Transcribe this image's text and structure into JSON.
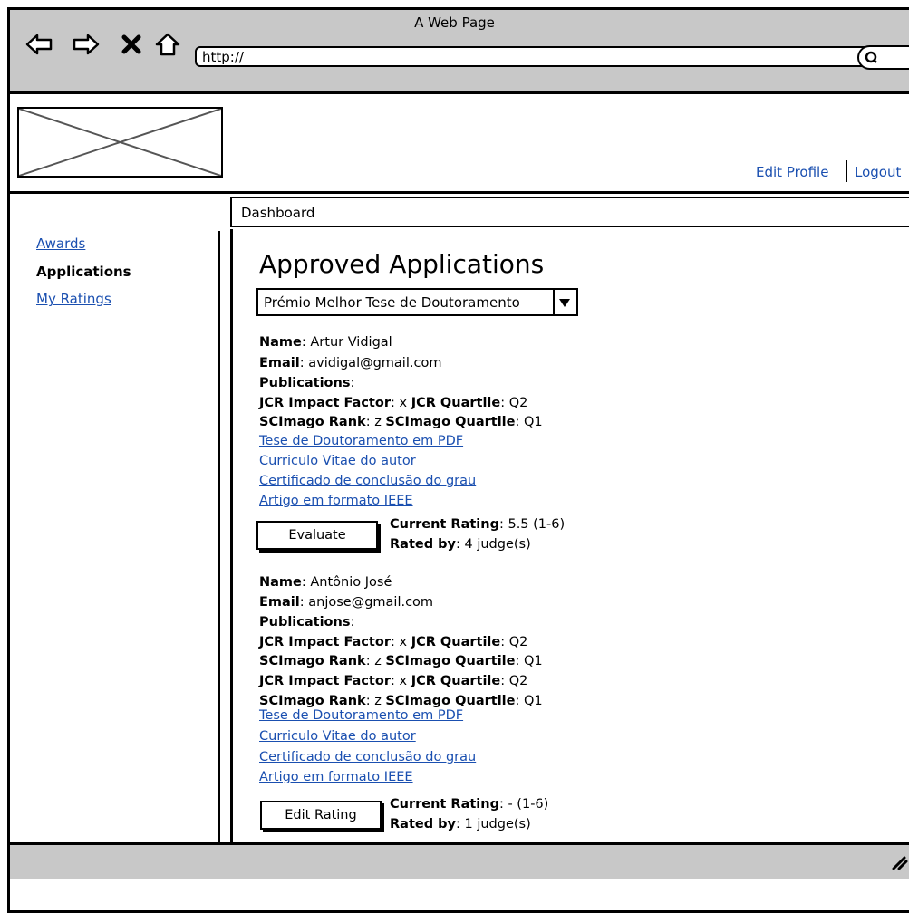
{
  "browser": {
    "title": "A Web Page",
    "url": "http://"
  },
  "header": {
    "edit_profile": "Edit Profile",
    "logout": "Logout"
  },
  "sidebar": {
    "items": [
      {
        "label": "Awards",
        "active": false
      },
      {
        "label": "Applications",
        "active": true
      },
      {
        "label": "My Ratings",
        "active": false
      }
    ]
  },
  "breadcrumb": "Dashboard",
  "main": {
    "heading": "Approved Applications",
    "award_select": "Prémio Melhor Tese de Doutoramento",
    "applications": [
      {
        "name_label": "Name",
        "name": "Artur Vidigal",
        "email_label": "Email",
        "email": "avidigal@gmail.com",
        "publications_label": "Publications",
        "metrics": [
          {
            "a_label": "JCR Impact Factor",
            "a": "x",
            "b_label": "JCR Quartile",
            "b": "Q2"
          },
          {
            "a_label": "SCImago Rank",
            "a": "z",
            "b_label": "SCImago Quartile",
            "b": "Q1"
          }
        ],
        "documents": [
          "Tese de Doutoramento em PDF",
          "Curriculo Vitae do autor",
          "Certificado de conclusão do grau",
          "Artigo em formato IEEE"
        ],
        "button": "Evaluate",
        "rating_label": "Current Rating",
        "rating": "5.5 (1-6)",
        "rated_by_label": "Rated by",
        "rated_by": "4 judge(s)"
      },
      {
        "name_label": "Name",
        "name": "Antônio José",
        "email_label": "Email",
        "email": "anjose@gmail.com",
        "publications_label": "Publications",
        "metrics": [
          {
            "a_label": "JCR Impact Factor",
            "a": "x",
            "b_label": "JCR Quartile",
            "b": "Q2"
          },
          {
            "a_label": "SCImago Rank",
            "a": "z",
            "b_label": "SCImago Quartile",
            "b": "Q1"
          },
          {
            "a_label": "JCR Impact Factor",
            "a": "x",
            "b_label": "JCR Quartile",
            "b": "Q2"
          },
          {
            "a_label": "SCImago Rank",
            "a": "z",
            "b_label": "SCImago Quartile",
            "b": "Q1"
          }
        ],
        "documents": [
          "Tese de Doutoramento em PDF",
          "Curriculo Vitae do autor",
          "Certificado de conclusão do grau",
          "Artigo em formato IEEE"
        ],
        "button": "Edit Rating",
        "rating_label": "Current Rating",
        "rating": "- (1-6)",
        "rated_by_label": "Rated by",
        "rated_by": "1 judge(s)"
      }
    ]
  }
}
